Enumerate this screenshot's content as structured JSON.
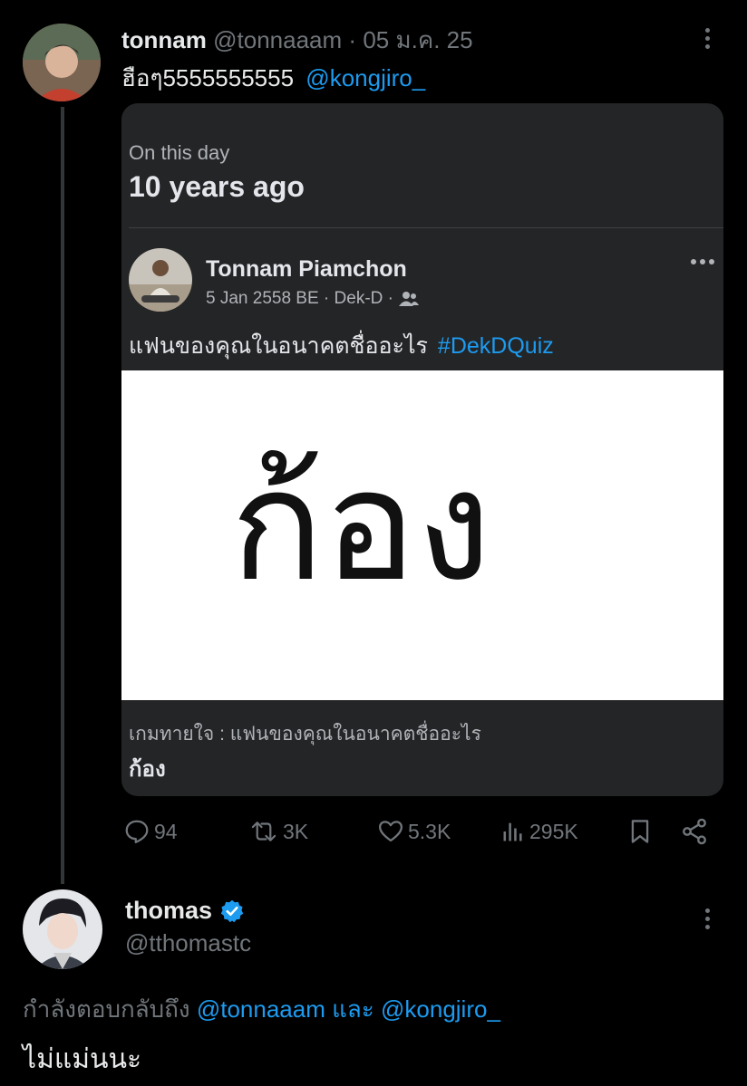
{
  "tweet": {
    "display_name": "tonnam",
    "handle": "@tonnaaam",
    "separator": "·",
    "date": "05 ม.ค. 25",
    "text": "ฮือๆ5555555555",
    "mention": "@kongjiro_",
    "card": {
      "section_label": "On this day",
      "headline": "10 years ago",
      "post_author": "Tonnam Piamchon",
      "post_meta": "5 Jan 2558 BE · Dek-D ·",
      "post_text": "แฟนของคุณในอนาคตชื่ออะไร",
      "hashtag": "#DekDQuiz",
      "image_text": "ก้อง",
      "caption_title": "เกมทายใจ : แฟนของคุณในอนาคตชื่ออะไร",
      "caption_answer": "ก้อง"
    },
    "actions": {
      "replies": "94",
      "reposts": "3K",
      "likes": "5.3K",
      "views": "295K"
    }
  },
  "reply": {
    "display_name": "thomas",
    "handle": "@tthomastc",
    "replying_prefix": "กำลังตอบกลับถึง",
    "replying_user1": "@tonnaaam",
    "replying_and": "และ",
    "replying_user2": "@kongjiro_",
    "text": "ไม่แม่นนะ"
  },
  "colors": {
    "background": "#000000",
    "link": "#1d9bf0",
    "muted": "#71767b",
    "card": "#242526",
    "verified": "#1d9bf0"
  },
  "icons": [
    "more-icon",
    "friends-icon",
    "reply-icon",
    "repost-icon",
    "like-icon",
    "views-icon",
    "bookmark-icon",
    "share-icon",
    "verified-badge-icon"
  ]
}
